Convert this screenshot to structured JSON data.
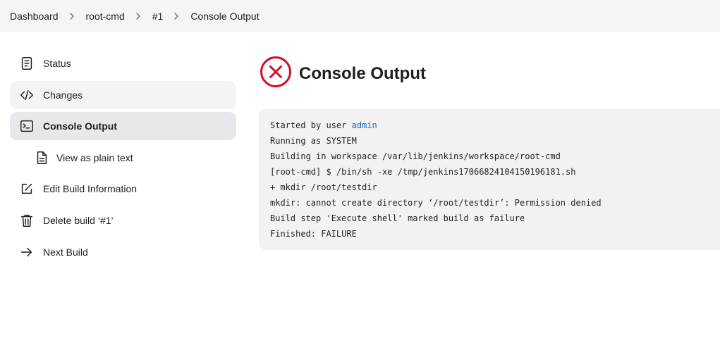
{
  "breadcrumb": {
    "items": [
      "Dashboard",
      "root-cmd",
      "#1",
      "Console Output"
    ]
  },
  "sidebar": {
    "items": [
      {
        "label": "Status",
        "icon": "document-icon"
      },
      {
        "label": "Changes",
        "icon": "code-icon"
      },
      {
        "label": "Console Output",
        "icon": "terminal-icon"
      },
      {
        "label": "View as plain text",
        "icon": "file-text-icon"
      },
      {
        "label": "Edit Build Information",
        "icon": "edit-icon"
      },
      {
        "label": "Delete build ‘#1’",
        "icon": "trash-icon"
      },
      {
        "label": "Next Build",
        "icon": "arrow-right-icon"
      }
    ]
  },
  "main": {
    "title": "Console Output",
    "status_icon": "failure-x-icon",
    "status_color": "#d20c27"
  },
  "console": {
    "started_prefix": "Started by user ",
    "user_link": "admin",
    "lines": [
      "Running as SYSTEM",
      "Building in workspace /var/lib/jenkins/workspace/root-cmd",
      "[root-cmd] $ /bin/sh -xe /tmp/jenkins17066824104150196181.sh",
      "+ mkdir /root/testdir",
      "mkdir: cannot create directory ‘/root/testdir’: Permission denied",
      "Build step 'Execute shell' marked build as failure",
      "Finished: FAILURE"
    ],
    "link_color": "#1965c0"
  }
}
